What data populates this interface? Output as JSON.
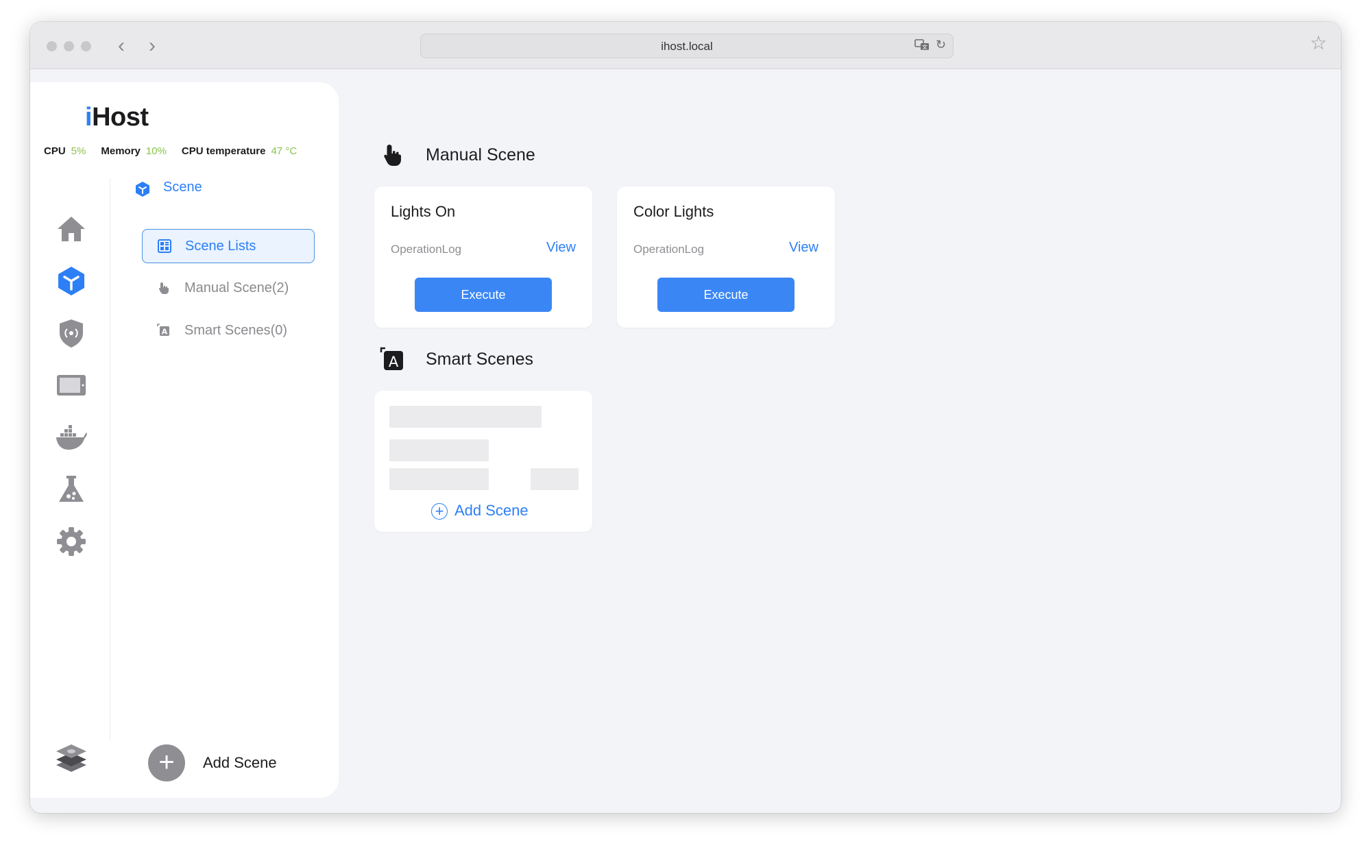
{
  "browser": {
    "url": "ihost.local"
  },
  "brand": {
    "prefix": "i",
    "name": "Host"
  },
  "stats": [
    {
      "label": "CPU",
      "value": "5%"
    },
    {
      "label": "Memory",
      "value": "10%"
    },
    {
      "label": "CPU temperature",
      "value": "47 °C"
    }
  ],
  "rail_icons": [
    "home-icon",
    "scene-cube-icon",
    "security-shield-icon",
    "display-icon",
    "docker-icon",
    "lab-flask-icon",
    "settings-gear-icon"
  ],
  "sidebar": {
    "section_label": "Scene",
    "items": [
      {
        "label": "Scene Lists",
        "icon": "scene-list-icon",
        "active": true
      },
      {
        "label": "Manual Scene(2)",
        "icon": "hand-pointer-icon",
        "active": false
      },
      {
        "label": "Smart Scenes(0)",
        "icon": "smart-scene-icon",
        "active": false
      }
    ],
    "add_scene_label": "Add Scene"
  },
  "main": {
    "manual_section": {
      "title": "Manual Scene",
      "cards": [
        {
          "title": "Lights On",
          "log_label": "OperationLog",
          "view_label": "View",
          "execute_label": "Execute"
        },
        {
          "title": "Color Lights",
          "log_label": "OperationLog",
          "view_label": "View",
          "execute_label": "Execute"
        }
      ]
    },
    "smart_section": {
      "title": "Smart Scenes",
      "add_scene_label": "Add Scene"
    }
  },
  "colors": {
    "accent": "#2d7ff5",
    "execute": "#3a86f5",
    "stat_value": "#8bc34a",
    "background": "#f3f4f8"
  }
}
